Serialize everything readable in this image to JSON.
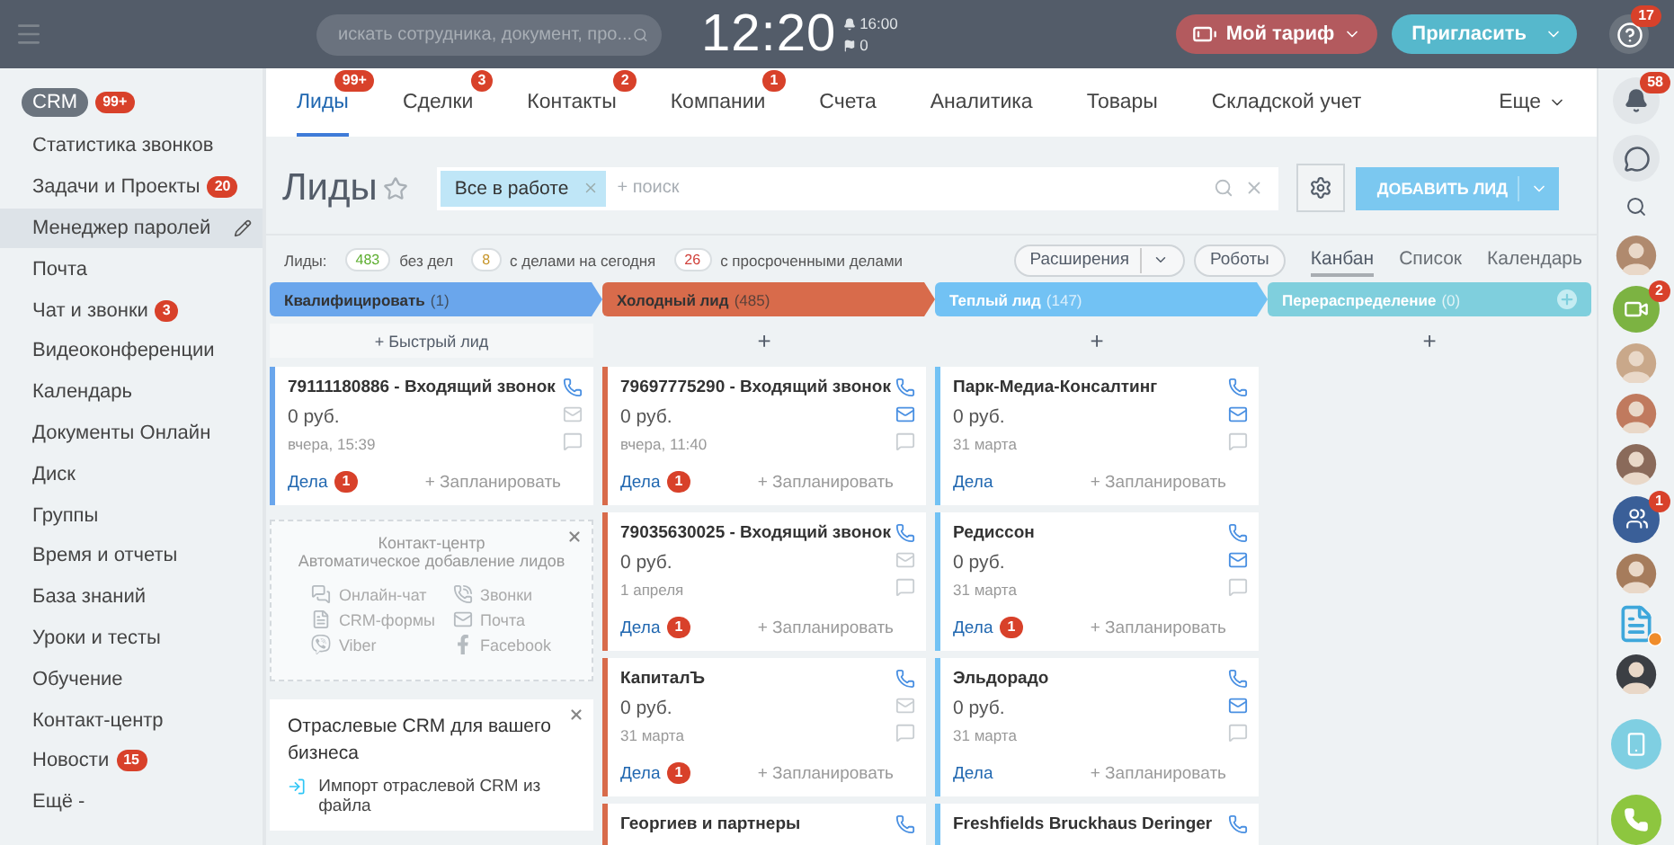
{
  "top_bar": {
    "search": {
      "placeholder": "искать сотрудника, документ, про..."
    },
    "clock": "12:20",
    "alarm": "16:00",
    "flags": "0",
    "tariff_button": "Мой тариф",
    "invite_button": "Пригласить",
    "help_badge": "17"
  },
  "sidebar": {
    "section": {
      "label": "CRM",
      "badge": "99+"
    },
    "items": [
      {
        "label": "Статистика звонков",
        "selected": false
      },
      {
        "label": "Задачи и Проекты",
        "badge": "20",
        "selected": false
      },
      {
        "label": "Менеджер паролей",
        "selected": true
      },
      {
        "label": "Почта",
        "selected": false
      },
      {
        "label": "Чат и звонки",
        "badge": "3",
        "selected": false
      },
      {
        "label": "Видеоконференции",
        "selected": false
      },
      {
        "label": "Календарь",
        "selected": false
      },
      {
        "label": "Документы Онлайн",
        "selected": false
      },
      {
        "label": "Диск",
        "selected": false
      },
      {
        "label": "Группы",
        "selected": false
      },
      {
        "label": "Время и отчеты",
        "selected": false
      },
      {
        "label": "База знаний",
        "selected": false
      },
      {
        "label": "Уроки и тесты",
        "selected": false
      },
      {
        "label": "Обучение",
        "selected": false
      },
      {
        "label": "Контакт-центр",
        "selected": false
      },
      {
        "label": "Новости",
        "badge": "15",
        "selected": false
      },
      {
        "label": "Ещё -",
        "selected": false
      }
    ]
  },
  "tabs": [
    {
      "label": "Лиды",
      "badge": "99+",
      "selected": true
    },
    {
      "label": "Сделки",
      "badge": "3",
      "selected": false
    },
    {
      "label": "Контакты",
      "badge": "2",
      "selected": false
    },
    {
      "label": "Компании",
      "badge": "1",
      "selected": false
    },
    {
      "label": "Счета",
      "selected": false
    },
    {
      "label": "Аналитика",
      "selected": false
    },
    {
      "label": "Товары",
      "selected": false
    },
    {
      "label": "Складской учет",
      "selected": false
    }
  ],
  "more_tab": "Еще",
  "toolbar": {
    "title": "Лиды",
    "filter_chip": "Все в работе",
    "filter_placeholder": "+ поиск",
    "add_button": "ДОБАВИТЬ ЛИД"
  },
  "counters": {
    "label": "Лиды:",
    "items": [
      {
        "count": "483",
        "text": "без дел",
        "color": "#5cad2e"
      },
      {
        "count": "8",
        "text": "с делами на сегодня",
        "color": "#c7962c"
      },
      {
        "count": "26",
        "text": "с просроченными делами",
        "color": "#d0403a"
      }
    ]
  },
  "actions": [
    "Расширения",
    "Роботы"
  ],
  "views": [
    {
      "label": "Канбан",
      "selected": true
    },
    {
      "label": "Список",
      "selected": false
    },
    {
      "label": "Календарь",
      "selected": false
    }
  ],
  "columns": [
    {
      "kind": "arrow",
      "title": "Квалифицировать",
      "count": "(1)",
      "color": "#6aa6ec",
      "dark_text": true,
      "add": "+ Быстрый лид",
      "quick": true,
      "cards": [
        {
          "title": "79111180886 - Входящий звонок",
          "amount": "0 руб.",
          "date": "вчера, 15:39",
          "deals": "Дела",
          "deals_badge": "1",
          "plan": "+ Запланировать",
          "mail_active": false
        }
      ],
      "widgets": [
        {
          "kind": "channels",
          "lines": [
            "Контакт-центр",
            "Автоматическое добавление лидов"
          ],
          "items": [
            {
              "kind": "chat",
              "label": "Онлайн-чат"
            },
            {
              "kind": "calls",
              "label": "Звонки"
            },
            {
              "kind": "forms",
              "label": "CRM-формы"
            },
            {
              "kind": "mail",
              "label": "Почта"
            },
            {
              "kind": "viber",
              "label": "Viber"
            },
            {
              "kind": "facebook",
              "label": "Facebook"
            }
          ]
        },
        {
          "kind": "industry",
          "lines": [
            "Отраслевые CRM для вашего бизнеса"
          ],
          "items": [
            {
              "kind": "import",
              "label": "Импорт отраслевой CRM из файла"
            }
          ]
        }
      ]
    },
    {
      "kind": "arrow",
      "title": "Холодный лид",
      "count": "(485)",
      "color": "#d86b4b",
      "dark_text": true,
      "add": "+",
      "quick": false,
      "cards": [
        {
          "title": "79697775290 - Входящий звонок",
          "amount": "0 руб.",
          "date": "вчера, 11:40",
          "deals": "Дела",
          "deals_badge": "1",
          "plan": "+ Запланировать",
          "mail_active": true
        },
        {
          "title": "79035630025 - Входящий звонок",
          "amount": "0 руб.",
          "date": "1 апреля",
          "deals": "Дела",
          "deals_badge": "1",
          "plan": "+ Запланировать",
          "mail_active": false
        },
        {
          "title": "КапиталЪ",
          "amount": "0 руб.",
          "date": "31 марта",
          "deals": "Дела",
          "deals_badge": "1",
          "plan": "+ Запланировать",
          "mail_active": false
        },
        {
          "title": "Георгиев и партнеры"
        }
      ]
    },
    {
      "kind": "arrow",
      "title": "Теплый лид",
      "count": "(147)",
      "color": "#72c2f4",
      "dark_text": false,
      "add": "+",
      "quick": false,
      "cards": [
        {
          "title": "Парк-Медиа-Консалтинг",
          "amount": "0 руб.",
          "date": "31 марта",
          "deals": "Дела",
          "plan": "+ Запланировать",
          "mail_active": true
        },
        {
          "title": "Редиссон",
          "amount": "0 руб.",
          "date": "31 марта",
          "deals": "Дела",
          "deals_badge": "1",
          "plan": "+ Запланировать",
          "mail_active": true
        },
        {
          "title": "Эльдорадо",
          "amount": "0 руб.",
          "date": "31 марта",
          "deals": "Дела",
          "plan": "+ Запланировать",
          "mail_active": true
        },
        {
          "title": "Freshfields Bruckhaus Deringer"
        }
      ]
    },
    {
      "kind": "final",
      "title": "Перераспределение",
      "count": "(0)",
      "color": "#7fcfdd",
      "dark_text": false,
      "add": "+",
      "quick": false
    }
  ],
  "rail": [
    {
      "kind": "bell",
      "badge": "58"
    },
    {
      "kind": "chat"
    },
    {
      "kind": "search"
    },
    {
      "kind": "avatar",
      "color": "#b08a6e"
    },
    {
      "kind": "video",
      "badge": "2"
    },
    {
      "kind": "avatar",
      "color": "#c9a88a"
    },
    {
      "kind": "avatar",
      "color": "#c07a5e"
    },
    {
      "kind": "avatar",
      "color": "#8a6a5a"
    },
    {
      "kind": "group",
      "badge": "1"
    },
    {
      "kind": "avatar",
      "color": "#a67c5c"
    },
    {
      "kind": "doc"
    },
    {
      "kind": "avatar",
      "color": "#3c3f44"
    },
    {
      "kind": "cloud"
    },
    {
      "kind": "call"
    }
  ]
}
